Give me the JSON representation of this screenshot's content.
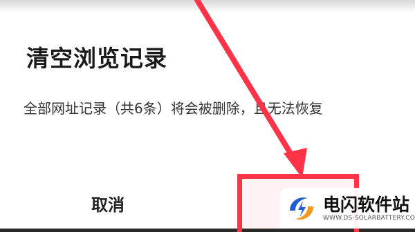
{
  "dialog": {
    "title": "清空浏览记录",
    "message": "全部网址记录（共6条）将会被删除，且无法恢复",
    "cancel_label": "取消",
    "confirm_label": ""
  },
  "annotation": {
    "color": "#ff3347",
    "arrow": "red-pointer-arrow",
    "target": "confirm-button"
  },
  "watermark": {
    "name": "电闪软件站",
    "url": "WWW.DS-SOLARBATTERY.COM",
    "logo": "lightning-swirl-logo"
  }
}
